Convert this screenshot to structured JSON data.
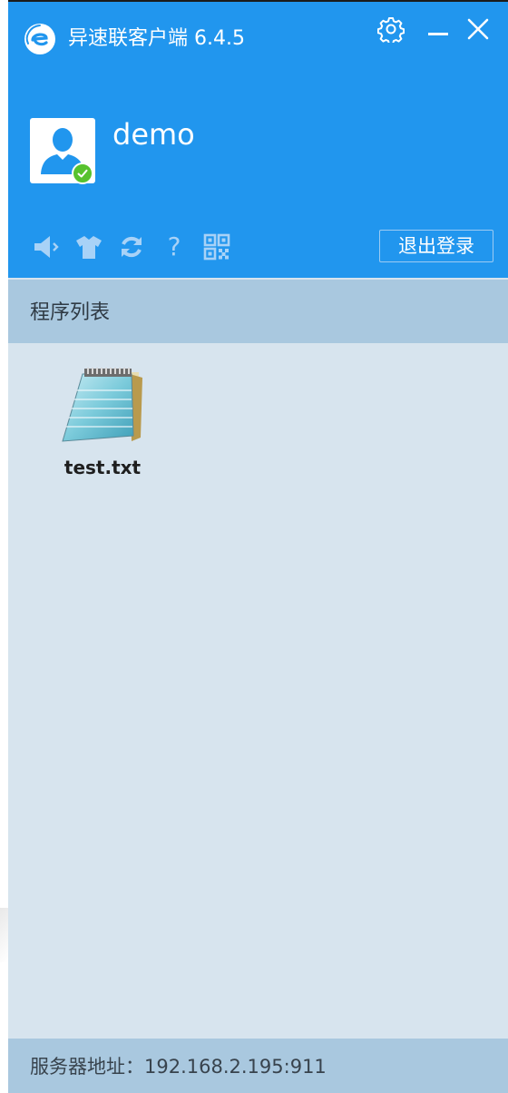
{
  "app": {
    "title": "异速联客户端 6.4.5",
    "brand_color": "#2196ee",
    "icons": {
      "logo": "app-logo-icon",
      "settings": "gear-icon",
      "minimize": "minimize-icon",
      "close": "close-icon"
    }
  },
  "user": {
    "name": "demo",
    "status": "online",
    "status_color": "#57c22e"
  },
  "toolbar": {
    "items": [
      {
        "icon": "speaker-icon"
      },
      {
        "icon": "shirt-icon"
      },
      {
        "icon": "refresh-icon"
      },
      {
        "icon": "help-icon",
        "glyph": "?"
      },
      {
        "icon": "qr-code-icon"
      }
    ],
    "logout_label": "退出登录"
  },
  "programs": {
    "section_title": "程序列表",
    "items": [
      {
        "label": "test.txt",
        "icon": "notepad-icon"
      }
    ]
  },
  "footer": {
    "server_address": "服务器地址：192.168.2.195:911"
  }
}
